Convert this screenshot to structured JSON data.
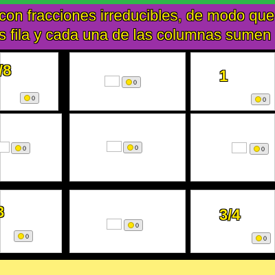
{
  "banner": {
    "line1": "con fracciones irreducibles, de modo que",
    "line2": "s fila y cada una de las columnas sumen"
  },
  "grid": {
    "cells": [
      {
        "fraction": "/8",
        "button_count": "0"
      },
      {
        "fraction": "",
        "button_count": "0"
      },
      {
        "fraction": "1",
        "button_count": "0"
      },
      {
        "fraction": "",
        "button_count": "0"
      },
      {
        "fraction": "",
        "button_count": "0"
      },
      {
        "fraction": "",
        "button_count": "0"
      },
      {
        "fraction": "3",
        "button_count": "0"
      },
      {
        "fraction": "",
        "button_count": "0"
      },
      {
        "fraction": "3/4",
        "button_count": "0"
      }
    ]
  },
  "colors": {
    "banner_bg": "#9a2fa6",
    "banner_text": "#ffea00",
    "top_stripe": "#2fb84a",
    "bottom_bar": "#fef17a",
    "button_dot": "#ffe300"
  },
  "icons": {
    "button_icon": "yellow-dot-icon"
  }
}
